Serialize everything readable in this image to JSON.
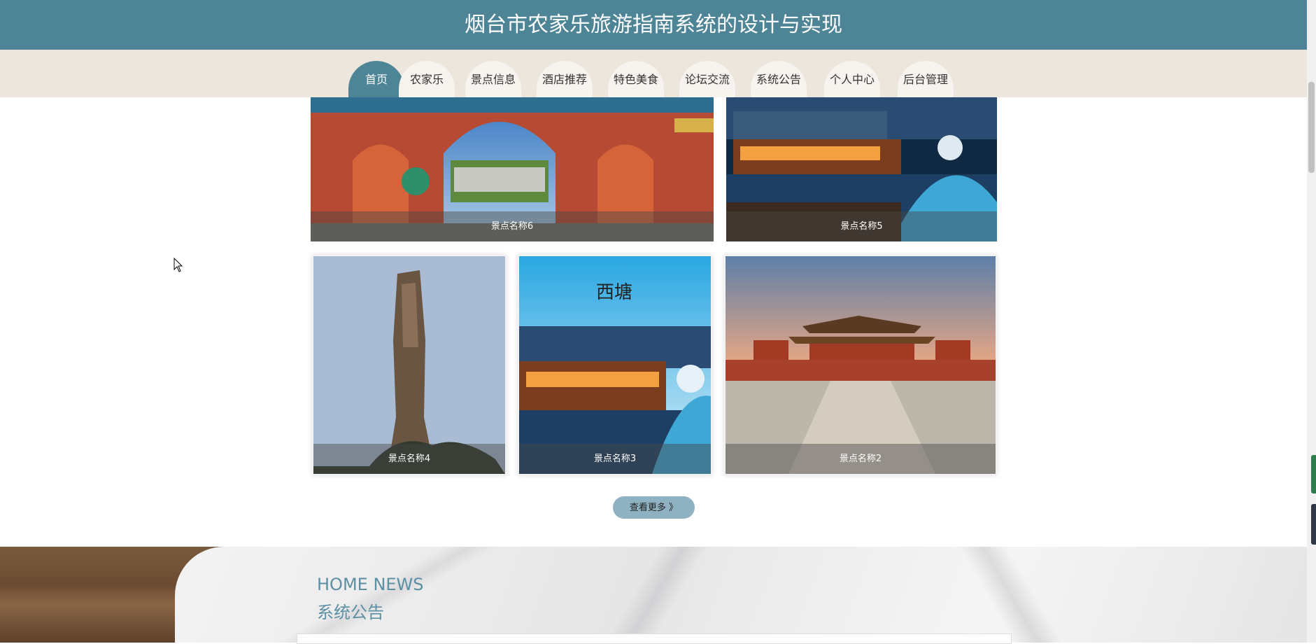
{
  "header": {
    "title": "烟台市农家乐旅游指南系统的设计与实现"
  },
  "nav": {
    "items": [
      "首页",
      "农家乐",
      "景点信息",
      "酒店推荐",
      "特色美食",
      "论坛交流",
      "系统公告",
      "个人中心",
      "后台管理"
    ],
    "active_index": 0
  },
  "gallery": {
    "cards": [
      {
        "caption": "景点名称6"
      },
      {
        "caption": "景点名称5"
      },
      {
        "caption": "景点名称4"
      },
      {
        "caption": "景点名称3"
      },
      {
        "caption": "景点名称2"
      }
    ],
    "watermark_text": "西塘",
    "more_button": "查看更多 》"
  },
  "news": {
    "title_en": "HOME NEWS",
    "title_cn": "系统公告"
  },
  "colors": {
    "brand": "#4d8496",
    "nav_bg": "#ece6dd",
    "button": "#8fb2c2"
  }
}
